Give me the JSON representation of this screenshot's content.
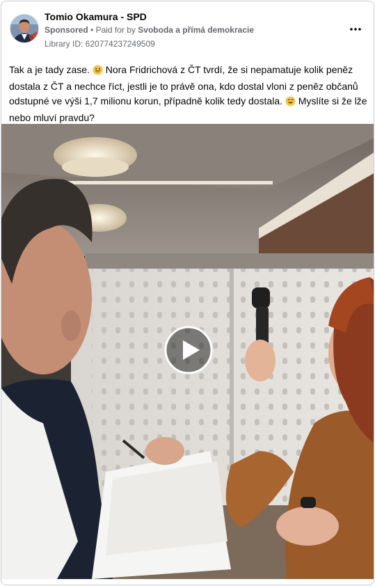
{
  "post": {
    "author": "Tomio Okamura - SPD",
    "sponsored_label": "Sponsored",
    "paid_prefix": "Paid for by",
    "payer": "Svoboda a přímá demokracie",
    "library_id": "Library ID: 620774237249509",
    "text_part1": "Tak a je tady zase.",
    "text_part2": " Nora Fridrichová z ČT tvrdí, že si nepamatuje kolik peněz dostala z ČT a nechce říct, jestli je to právě ona, kdo dostal vloni z peněz občanů odstupné ve výši 1,7 milionu korun, případně kolik tedy dostala.",
    "text_part3": " Myslíte si že lže nebo mluví pravdu?",
    "emoji1": "grinning-face-emoji",
    "emoji2": "grinning-sweat-emoji"
  },
  "icons": {
    "more": "more-horizontal-icon",
    "play": "play-icon"
  },
  "colors": {
    "text_primary": "#050505",
    "text_secondary": "#65676b",
    "border": "#c9ccd1"
  }
}
